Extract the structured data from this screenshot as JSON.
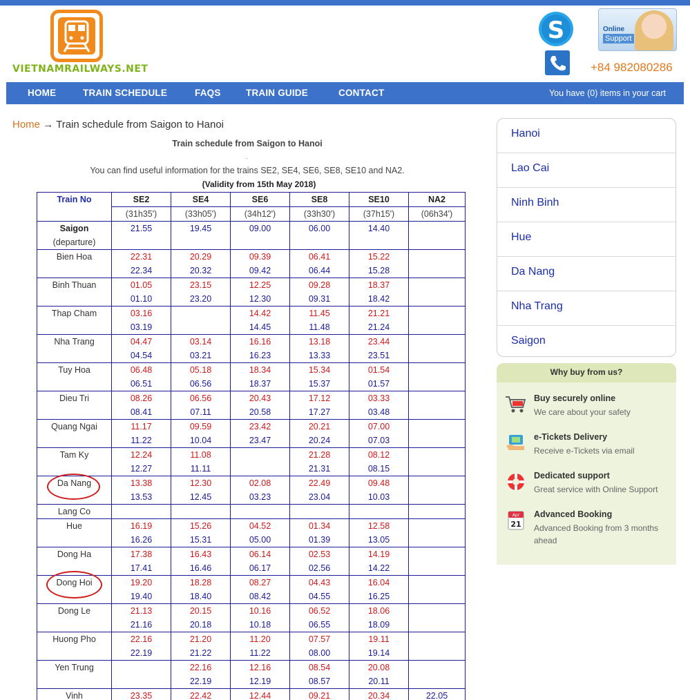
{
  "site": {
    "logo_text": "VIETNAMRAILWAYS.NET",
    "support_line1": "Online",
    "support_line2": "Support",
    "phone": "+84 982080286"
  },
  "nav": {
    "items": [
      "HOME",
      "TRAIN SCHEDULE",
      "FAQS",
      "TRAIN GUIDE",
      "CONTACT"
    ],
    "cart": "You have (0) items in your cart"
  },
  "breadcrumb": {
    "home": "Home",
    "arrow": "→",
    "current": "Train schedule from Saigon to Hanoi"
  },
  "content": {
    "title": "Train schedule from Saigon to Hanoi",
    "dot": ".",
    "info": "You can find useful information for the trains SE2, SE4, SE6, SE8, SE10 and NA2.",
    "validity": "(Validity from 15th May 2018)"
  },
  "schedule": {
    "header": [
      "Train No",
      "SE2",
      "SE4",
      "SE6",
      "SE8",
      "SE10",
      "NA2"
    ],
    "durations": [
      "(31h35')",
      "(33h05')",
      "(34h12')",
      "(33h30')",
      "(37h15')",
      "(06h34')"
    ],
    "rows": [
      {
        "station": "Saigon",
        "note": "(departure)",
        "times": [
          [
            "21.55",
            ""
          ],
          [
            "19.45",
            ""
          ],
          [
            "09.00",
            ""
          ],
          [
            "06.00",
            ""
          ],
          [
            "14.40",
            ""
          ],
          [
            "",
            ""
          ]
        ]
      },
      {
        "station": "Bien Hoa",
        "times": [
          [
            "22.31",
            "22.34"
          ],
          [
            "20.29",
            "20.32"
          ],
          [
            "09.39",
            "09.42"
          ],
          [
            "06.41",
            "06.44"
          ],
          [
            "15.22",
            "15.28"
          ],
          [
            "",
            ""
          ]
        ]
      },
      {
        "station": "Binh Thuan",
        "times": [
          [
            "01.05",
            "01.10"
          ],
          [
            "23.15",
            "23.20"
          ],
          [
            "12.25",
            "12.30"
          ],
          [
            "09.28",
            "09.31"
          ],
          [
            "18.37",
            "18.42"
          ],
          [
            "",
            ""
          ]
        ]
      },
      {
        "station": "Thap Cham",
        "times": [
          [
            "03.16",
            "03.19"
          ],
          [
            "",
            ""
          ],
          [
            "14.42",
            "14.45"
          ],
          [
            "11.45",
            "11.48"
          ],
          [
            "21.21",
            "21.24"
          ],
          [
            "",
            ""
          ]
        ]
      },
      {
        "station": "Nha Trang",
        "times": [
          [
            "04.47",
            "04.54"
          ],
          [
            "03.14",
            "03.21"
          ],
          [
            "16.16",
            "16.23"
          ],
          [
            "13.18",
            "13.33"
          ],
          [
            "23.44",
            "23.51"
          ],
          [
            "",
            ""
          ]
        ]
      },
      {
        "station": "Tuy Hoa",
        "times": [
          [
            "06.48",
            "06.51"
          ],
          [
            "05.18",
            "06.56"
          ],
          [
            "18.34",
            "18.37"
          ],
          [
            "15.34",
            "15.37"
          ],
          [
            "01.54",
            "01.57"
          ],
          [
            "",
            ""
          ]
        ]
      },
      {
        "station": "Dieu Tri",
        "times": [
          [
            "08.26",
            "08.41"
          ],
          [
            "06.56",
            "07.11"
          ],
          [
            "20.43",
            "20.58"
          ],
          [
            "17.12",
            "17.27"
          ],
          [
            "03.33",
            "03.48"
          ],
          [
            "",
            ""
          ]
        ]
      },
      {
        "station": "Quang Ngai",
        "times": [
          [
            "11.17",
            "11.22"
          ],
          [
            "09.59",
            "10.04"
          ],
          [
            "23.42",
            "23.47"
          ],
          [
            "20.21",
            "20.24"
          ],
          [
            "07.00",
            "07.03"
          ],
          [
            "",
            ""
          ]
        ]
      },
      {
        "station": "Tam Ky",
        "times": [
          [
            "12.24",
            "12.27"
          ],
          [
            "11.08",
            "11.11"
          ],
          [
            "",
            ""
          ],
          [
            "21.28",
            "21.31"
          ],
          [
            "08.12",
            "08.15"
          ],
          [
            "",
            ""
          ]
        ]
      },
      {
        "station": "Da Nang",
        "times": [
          [
            "13.38",
            "13.53"
          ],
          [
            "12.30",
            "12.45"
          ],
          [
            "02.08",
            "03.23"
          ],
          [
            "22.49",
            "23.04"
          ],
          [
            "09.48",
            "10.03"
          ],
          [
            "",
            ""
          ]
        ]
      },
      {
        "station": "Lang Co",
        "single": true,
        "times": [
          [
            "",
            ""
          ],
          [
            "",
            ""
          ],
          [
            "",
            ""
          ],
          [
            "",
            ""
          ],
          [
            "",
            ""
          ],
          [
            "",
            ""
          ]
        ]
      },
      {
        "station": "Hue",
        "times": [
          [
            "16.19",
            "16.26"
          ],
          [
            "15.26",
            "15.31"
          ],
          [
            "04.52",
            "05.00"
          ],
          [
            "01.34",
            "01.39"
          ],
          [
            "12.58",
            "13.05"
          ],
          [
            "",
            ""
          ]
        ]
      },
      {
        "station": "Dong Ha",
        "times": [
          [
            "17.38",
            "17.41"
          ],
          [
            "16.43",
            "16.46"
          ],
          [
            "06.14",
            "06.17"
          ],
          [
            "02.53",
            "02.56"
          ],
          [
            "14.19",
            "14.22"
          ],
          [
            "",
            ""
          ]
        ]
      },
      {
        "station": "Dong Hoi",
        "times": [
          [
            "19.20",
            "19.40"
          ],
          [
            "18.28",
            "18.40"
          ],
          [
            "08.27",
            "08.42"
          ],
          [
            "04.43",
            "04.55"
          ],
          [
            "16.04",
            "16.25"
          ],
          [
            "",
            ""
          ]
        ]
      },
      {
        "station": "Dong Le",
        "times": [
          [
            "21.13",
            "21.16"
          ],
          [
            "20.15",
            "20.18"
          ],
          [
            "10.16",
            "10.18"
          ],
          [
            "06.52",
            "06.55"
          ],
          [
            "18.06",
            "18.09"
          ],
          [
            "",
            ""
          ]
        ]
      },
      {
        "station": "Huong Pho",
        "times": [
          [
            "22.16",
            "22.19"
          ],
          [
            "21.20",
            "21.22"
          ],
          [
            "11.20",
            "11.22"
          ],
          [
            "07.57",
            "08.00"
          ],
          [
            "19.11",
            "19.14"
          ],
          [
            "",
            ""
          ]
        ]
      },
      {
        "station": "Yen Trung",
        "times": [
          [
            "",
            ""
          ],
          [
            "22.16",
            "22.19"
          ],
          [
            "12.16",
            "12.19"
          ],
          [
            "08.54",
            "08.57"
          ],
          [
            "20.08",
            "20.11"
          ],
          [
            "",
            ""
          ]
        ]
      },
      {
        "station": "Vinh",
        "times": [
          [
            "23.35",
            ""
          ],
          [
            "22.42",
            ""
          ],
          [
            "12.44",
            ""
          ],
          [
            "09.21",
            ""
          ],
          [
            "20.34",
            ""
          ],
          [
            "22.05",
            ""
          ]
        ]
      }
    ]
  },
  "sidebar": {
    "destinations": [
      "Hanoi",
      "Lao Cai",
      "Ninh Binh",
      "Hue",
      "Da Nang",
      "Nha Trang",
      "Saigon"
    ],
    "why_title": "Why buy from us?",
    "why_items": [
      {
        "title": "Buy securely online",
        "desc": "We care about your safety",
        "icon": "shopping-cart-icon"
      },
      {
        "title": "e-Tickets Delivery",
        "desc": "Receive e-Tickets via email",
        "icon": "ticket-delivery-icon"
      },
      {
        "title": "Dedicated support",
        "desc": "Great service with Online Support",
        "icon": "lifebuoy-icon"
      },
      {
        "title": "Advanced Booking",
        "desc": "Advanced Booking from 3 months ahead",
        "icon": "calendar-icon"
      }
    ],
    "calendar_month": "Apr",
    "calendar_day": "21"
  },
  "colors": {
    "nav_blue": "#3c72c9",
    "accent_orange": "#f08a1c",
    "logo_green": "#7fb41a",
    "arrival_red": "#d01818",
    "departure_blue": "#1a1a9a"
  }
}
